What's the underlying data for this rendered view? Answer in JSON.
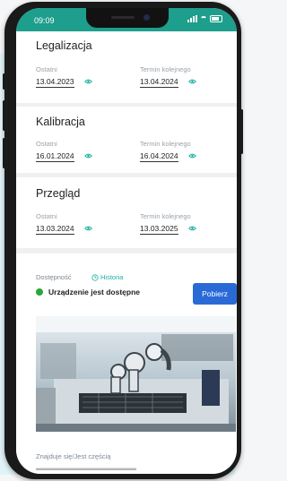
{
  "status_bar": {
    "time": "09:09"
  },
  "sections": [
    {
      "title": "Legalizacja",
      "last_label": "Ostatni",
      "last_value": "13.04.2023",
      "next_label": "Termin kolejnego",
      "next_value": "13.04.2024"
    },
    {
      "title": "Kalibracja",
      "last_label": "Ostatni",
      "last_value": "16.01.2024",
      "next_label": "Termin kolejnego",
      "next_value": "16.04.2024"
    },
    {
      "title": "Przegląd",
      "last_label": "Ostatni",
      "last_value": "13.03.2024",
      "next_label": "Termin kolejnego",
      "next_value": "13.03.2025"
    }
  ],
  "availability": {
    "tab_label": "Dostępność",
    "history_label": "Historia",
    "status_text": "Urządzenie jest dostępne",
    "status_color": "#2aa63a",
    "download_button": "Pobierz"
  },
  "location": {
    "label": "Znajduje się/Jest częścią"
  },
  "colors": {
    "accent": "#1e9e8c",
    "primary_button": "#2a6ad6",
    "link": "#1ab0a0"
  }
}
